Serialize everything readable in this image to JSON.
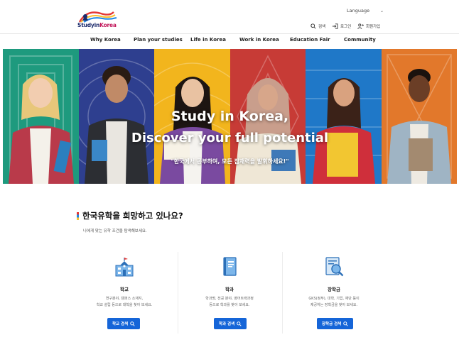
{
  "header": {
    "logo_text_a": "Studyin",
    "logo_text_b": "Korea",
    "language_label": "Language",
    "utility": {
      "search_label": "검색",
      "login_label": "로그인",
      "signup_label": "회원가입"
    }
  },
  "nav": {
    "items": [
      {
        "label": "Why Korea"
      },
      {
        "label": "Plan your studies"
      },
      {
        "label": "Life in Korea"
      },
      {
        "label": "Work in Korea"
      },
      {
        "label": "Education Fair"
      },
      {
        "label": "Community"
      }
    ]
  },
  "hero": {
    "title_line1": "Study in Korea,",
    "title_line2": "Discover your full potential",
    "subtitle": "\"한국에서 공부하며, 모든 잠재력을 발휘하세요!\"",
    "panel_colors": [
      "#1e9a7e",
      "#2e3f8f",
      "#f2b51d",
      "#c73b36",
      "#1f78c8",
      "#e2782b"
    ]
  },
  "section": {
    "title": "한국유학을 희망하고 있나요?",
    "description": "나에게 맞는 유학 조건을 탐색해보세요.",
    "cards": [
      {
        "title": "학교",
        "desc_line1": "연구분야, 캠퍼스 소재지,",
        "desc_line2": "학교 설립 등으로 대학을 찾아 보세요.",
        "button": "학교 검색"
      },
      {
        "title": "학과",
        "desc_line1": "학과명, 전공 분야, 영어트랙과정",
        "desc_line2": "등으로 학과를 찾아 보세요.",
        "button": "학과 검색"
      },
      {
        "title": "장학금",
        "desc_line1": "GKS(정부), 대학, 기업, 재단 등이",
        "desc_line2": "제공하는 장학금을 찾아 보세요.",
        "button": "장학금 검색"
      }
    ]
  },
  "colors": {
    "accent_blue": "#1565d8",
    "icon_blue": "#4a90d9"
  }
}
